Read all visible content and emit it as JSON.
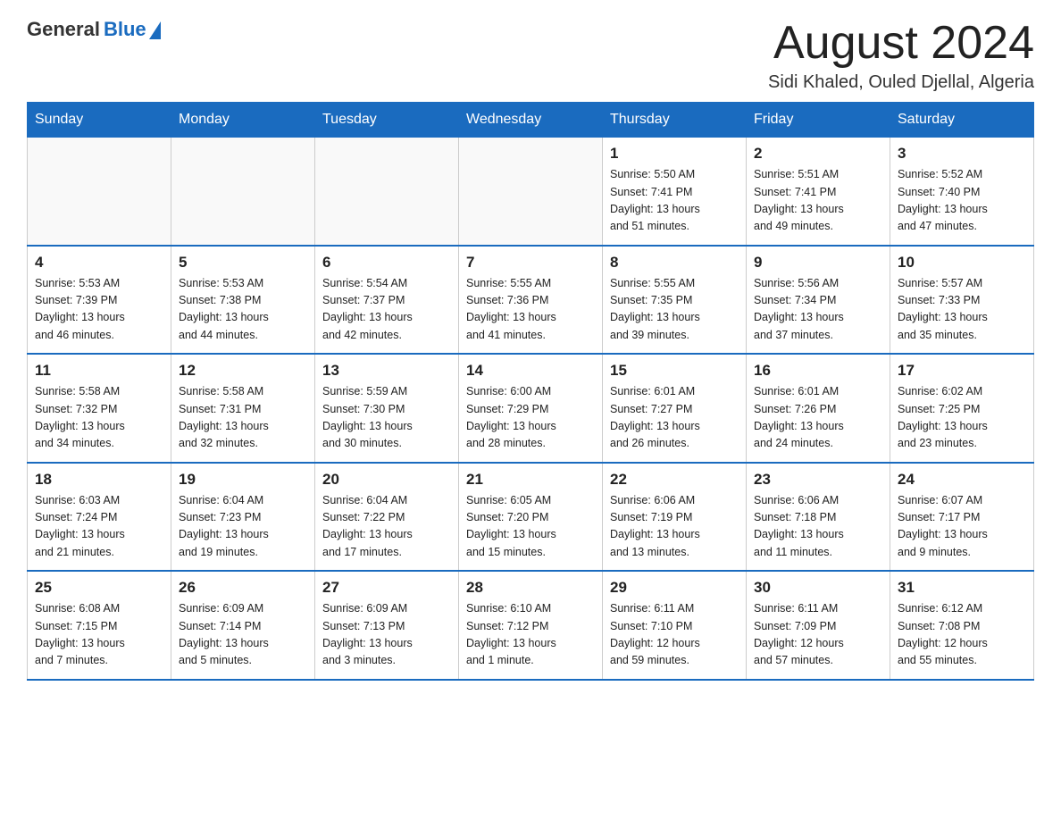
{
  "header": {
    "logo_general": "General",
    "logo_blue": "Blue",
    "month_title": "August 2024",
    "location": "Sidi Khaled, Ouled Djellal, Algeria"
  },
  "days_of_week": [
    "Sunday",
    "Monday",
    "Tuesday",
    "Wednesday",
    "Thursday",
    "Friday",
    "Saturday"
  ],
  "weeks": [
    [
      {
        "day": "",
        "info": ""
      },
      {
        "day": "",
        "info": ""
      },
      {
        "day": "",
        "info": ""
      },
      {
        "day": "",
        "info": ""
      },
      {
        "day": "1",
        "info": "Sunrise: 5:50 AM\nSunset: 7:41 PM\nDaylight: 13 hours\nand 51 minutes."
      },
      {
        "day": "2",
        "info": "Sunrise: 5:51 AM\nSunset: 7:41 PM\nDaylight: 13 hours\nand 49 minutes."
      },
      {
        "day": "3",
        "info": "Sunrise: 5:52 AM\nSunset: 7:40 PM\nDaylight: 13 hours\nand 47 minutes."
      }
    ],
    [
      {
        "day": "4",
        "info": "Sunrise: 5:53 AM\nSunset: 7:39 PM\nDaylight: 13 hours\nand 46 minutes."
      },
      {
        "day": "5",
        "info": "Sunrise: 5:53 AM\nSunset: 7:38 PM\nDaylight: 13 hours\nand 44 minutes."
      },
      {
        "day": "6",
        "info": "Sunrise: 5:54 AM\nSunset: 7:37 PM\nDaylight: 13 hours\nand 42 minutes."
      },
      {
        "day": "7",
        "info": "Sunrise: 5:55 AM\nSunset: 7:36 PM\nDaylight: 13 hours\nand 41 minutes."
      },
      {
        "day": "8",
        "info": "Sunrise: 5:55 AM\nSunset: 7:35 PM\nDaylight: 13 hours\nand 39 minutes."
      },
      {
        "day": "9",
        "info": "Sunrise: 5:56 AM\nSunset: 7:34 PM\nDaylight: 13 hours\nand 37 minutes."
      },
      {
        "day": "10",
        "info": "Sunrise: 5:57 AM\nSunset: 7:33 PM\nDaylight: 13 hours\nand 35 minutes."
      }
    ],
    [
      {
        "day": "11",
        "info": "Sunrise: 5:58 AM\nSunset: 7:32 PM\nDaylight: 13 hours\nand 34 minutes."
      },
      {
        "day": "12",
        "info": "Sunrise: 5:58 AM\nSunset: 7:31 PM\nDaylight: 13 hours\nand 32 minutes."
      },
      {
        "day": "13",
        "info": "Sunrise: 5:59 AM\nSunset: 7:30 PM\nDaylight: 13 hours\nand 30 minutes."
      },
      {
        "day": "14",
        "info": "Sunrise: 6:00 AM\nSunset: 7:29 PM\nDaylight: 13 hours\nand 28 minutes."
      },
      {
        "day": "15",
        "info": "Sunrise: 6:01 AM\nSunset: 7:27 PM\nDaylight: 13 hours\nand 26 minutes."
      },
      {
        "day": "16",
        "info": "Sunrise: 6:01 AM\nSunset: 7:26 PM\nDaylight: 13 hours\nand 24 minutes."
      },
      {
        "day": "17",
        "info": "Sunrise: 6:02 AM\nSunset: 7:25 PM\nDaylight: 13 hours\nand 23 minutes."
      }
    ],
    [
      {
        "day": "18",
        "info": "Sunrise: 6:03 AM\nSunset: 7:24 PM\nDaylight: 13 hours\nand 21 minutes."
      },
      {
        "day": "19",
        "info": "Sunrise: 6:04 AM\nSunset: 7:23 PM\nDaylight: 13 hours\nand 19 minutes."
      },
      {
        "day": "20",
        "info": "Sunrise: 6:04 AM\nSunset: 7:22 PM\nDaylight: 13 hours\nand 17 minutes."
      },
      {
        "day": "21",
        "info": "Sunrise: 6:05 AM\nSunset: 7:20 PM\nDaylight: 13 hours\nand 15 minutes."
      },
      {
        "day": "22",
        "info": "Sunrise: 6:06 AM\nSunset: 7:19 PM\nDaylight: 13 hours\nand 13 minutes."
      },
      {
        "day": "23",
        "info": "Sunrise: 6:06 AM\nSunset: 7:18 PM\nDaylight: 13 hours\nand 11 minutes."
      },
      {
        "day": "24",
        "info": "Sunrise: 6:07 AM\nSunset: 7:17 PM\nDaylight: 13 hours\nand 9 minutes."
      }
    ],
    [
      {
        "day": "25",
        "info": "Sunrise: 6:08 AM\nSunset: 7:15 PM\nDaylight: 13 hours\nand 7 minutes."
      },
      {
        "day": "26",
        "info": "Sunrise: 6:09 AM\nSunset: 7:14 PM\nDaylight: 13 hours\nand 5 minutes."
      },
      {
        "day": "27",
        "info": "Sunrise: 6:09 AM\nSunset: 7:13 PM\nDaylight: 13 hours\nand 3 minutes."
      },
      {
        "day": "28",
        "info": "Sunrise: 6:10 AM\nSunset: 7:12 PM\nDaylight: 13 hours\nand 1 minute."
      },
      {
        "day": "29",
        "info": "Sunrise: 6:11 AM\nSunset: 7:10 PM\nDaylight: 12 hours\nand 59 minutes."
      },
      {
        "day": "30",
        "info": "Sunrise: 6:11 AM\nSunset: 7:09 PM\nDaylight: 12 hours\nand 57 minutes."
      },
      {
        "day": "31",
        "info": "Sunrise: 6:12 AM\nSunset: 7:08 PM\nDaylight: 12 hours\nand 55 minutes."
      }
    ]
  ]
}
